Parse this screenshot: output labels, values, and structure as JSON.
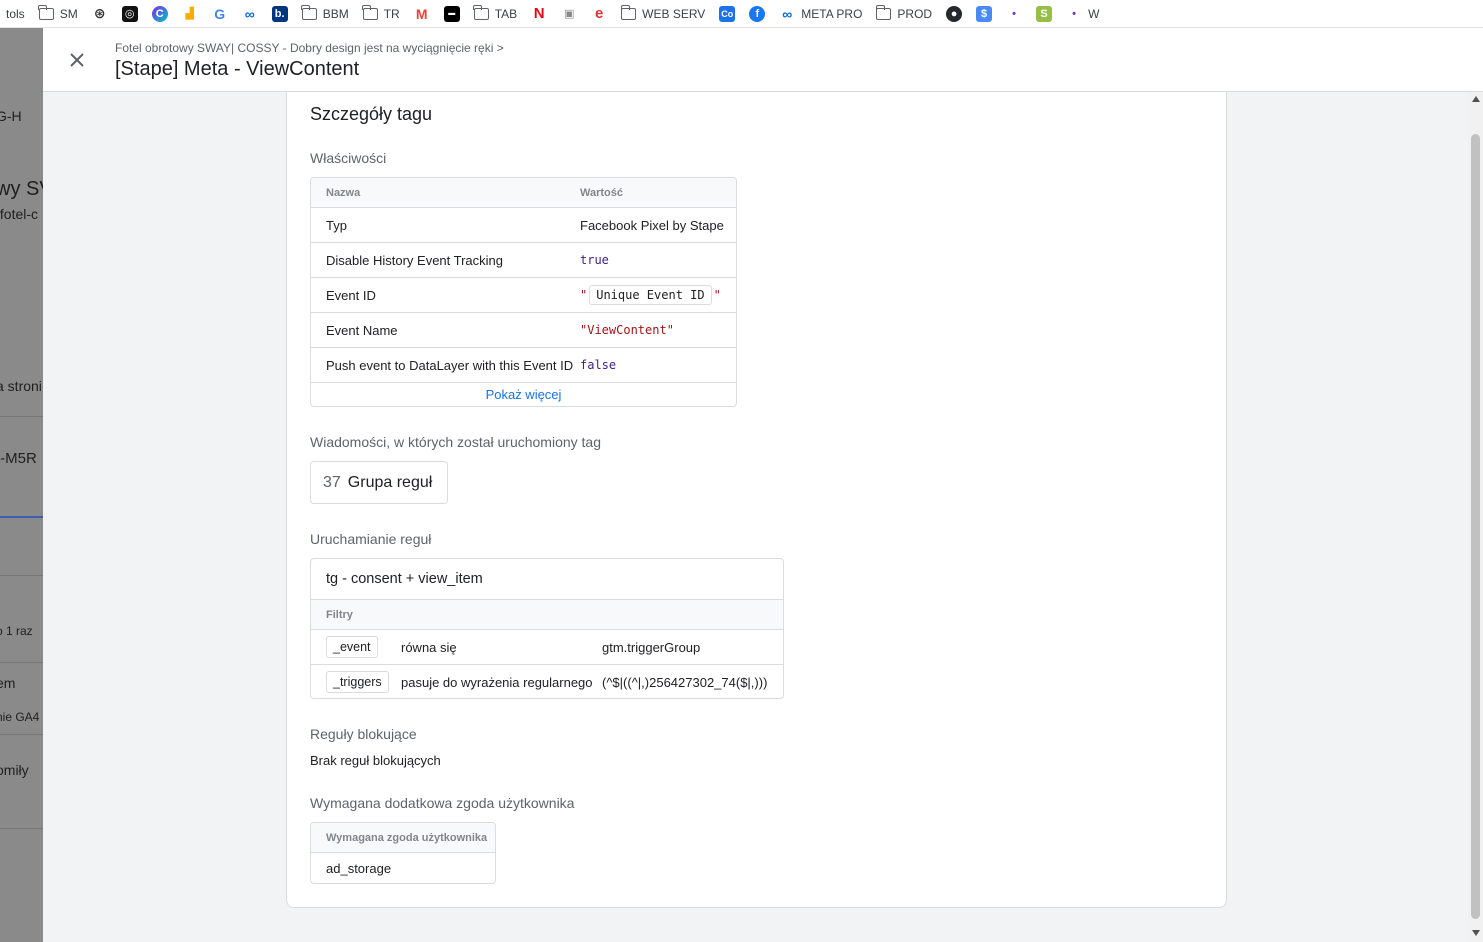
{
  "bookmarks": [
    {
      "label": "tols",
      "icon": "none"
    },
    {
      "label": "SM",
      "icon": "folder-icon"
    },
    {
      "label": "",
      "icon": "openai-icon"
    },
    {
      "label": "",
      "icon": "app-icon"
    },
    {
      "label": "",
      "icon": "canva-icon"
    },
    {
      "label": "",
      "icon": "analytics-icon"
    },
    {
      "label": "",
      "icon": "google-icon"
    },
    {
      "label": "",
      "icon": "meta-icon"
    },
    {
      "label": "",
      "icon": "booking-icon"
    },
    {
      "label": "BBM",
      "icon": "folder-icon"
    },
    {
      "label": "TR",
      "icon": "folder-icon"
    },
    {
      "label": "",
      "icon": "gmail-icon"
    },
    {
      "label": "",
      "icon": "app-icon"
    },
    {
      "label": "TAB",
      "icon": "folder-icon"
    },
    {
      "label": "",
      "icon": "netflix-icon"
    },
    {
      "label": "",
      "icon": "printer-icon"
    },
    {
      "label": "",
      "icon": "e-icon"
    },
    {
      "label": "WEB SERV",
      "icon": "folder-icon"
    },
    {
      "label": "",
      "icon": "app-icon"
    },
    {
      "label": "",
      "icon": "facebook-icon"
    },
    {
      "label": "META PRO",
      "icon": "meta-icon"
    },
    {
      "label": "PROD",
      "icon": "folder-icon"
    },
    {
      "label": "",
      "icon": "github-icon"
    },
    {
      "label": "",
      "icon": "app-icon"
    },
    {
      "label": "",
      "icon": "app-icon"
    },
    {
      "label": "",
      "icon": "shopify-icon"
    },
    {
      "label": "W",
      "icon": "app-icon"
    }
  ],
  "background": {
    "texts": [
      "G-H",
      "wy SV",
      "/fotel-c",
      "a stroni",
      "I-M5R",
      "o 1 raz",
      "em",
      "nie GA4",
      "omiły"
    ]
  },
  "header": {
    "breadcrumb": "Fotel obrotowy SWAY| COSSY - Dobry design jest na wyciągnięcie ręki >",
    "title": "[Stape] Meta - ViewContent"
  },
  "card": {
    "heading": "Szczegóły tagu",
    "properties": {
      "heading": "Właściwości",
      "col_name": "Nazwa",
      "col_value": "Wartość",
      "rows": [
        {
          "name": "Typ",
          "value": "Facebook Pixel by Stape",
          "kind": "text"
        },
        {
          "name": "Disable History Event Tracking",
          "value": "true",
          "kind": "keyword"
        },
        {
          "name": "Event ID",
          "quote_open": "\"",
          "value": "Unique Event ID",
          "quote_close": "\"",
          "kind": "variable"
        },
        {
          "name": "Event Name",
          "value": "\"ViewContent\"",
          "kind": "string"
        },
        {
          "name": "Push event to DataLayer with this Event ID",
          "value": "false",
          "kind": "keyword"
        }
      ],
      "show_more": "Pokaż więcej"
    },
    "messages": {
      "heading": "Wiadomości, w których został uruchomiony tag",
      "count": "37",
      "label": "Grupa reguł"
    },
    "firing": {
      "heading": "Uruchamianie reguł",
      "trigger_name": "tg - consent + view_item",
      "filters_label": "Filtry",
      "filters": [
        {
          "variable": "_event",
          "operator": "równa się",
          "value": "gtm.triggerGroup"
        },
        {
          "variable": "_triggers",
          "operator": "pasuje do wyrażenia regularnego",
          "value": "(^$|((^|,)256427302_74($|,)))"
        }
      ]
    },
    "blocking": {
      "heading": "Reguły blokujące",
      "text": "Brak reguł blokujących"
    },
    "consent": {
      "heading": "Wymagana dodatkowa zgoda użytkownika",
      "col": "Wymagana zgoda użytkownika",
      "value": "ad_storage"
    }
  }
}
